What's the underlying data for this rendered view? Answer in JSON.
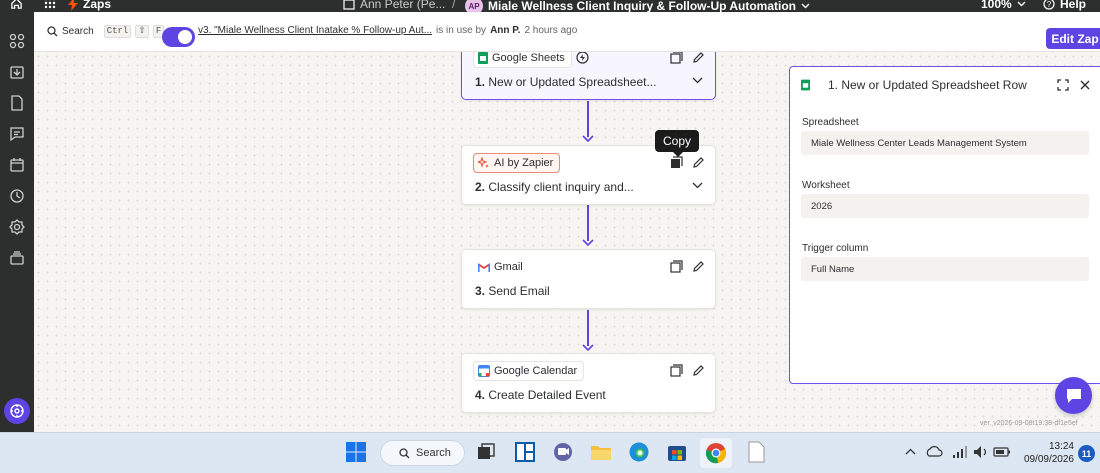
{
  "topbar": {
    "app_label": "Zaps",
    "owner": "Ann Peter (Pe...",
    "breadcrumb_separator": "/",
    "avatar_initials": "AP",
    "zap_title": "Miale Wellness Client Inquiry & Follow-Up Automation",
    "zoom": "100%",
    "help": "Help"
  },
  "subheader": {
    "search_label": "Search",
    "shortcut_keys": [
      "Ctrl",
      "⇧",
      "F"
    ],
    "toggle_on": true,
    "version_text": "v3. \"Miale Wellness Client Inatake % Follow-up Aut...",
    "in_use_text": "is in use by",
    "in_use_user": "Ann P.",
    "time_ago": "2 hours ago",
    "edit_button": "Edit Zap"
  },
  "steps": [
    {
      "app": "Google Sheets",
      "number": "1.",
      "title": "New or Updated Spreadsheet...",
      "selected": true,
      "icon": "google-sheets-icon"
    },
    {
      "app": "AI by Zapier",
      "number": "2.",
      "title": "Classify client inquiry and...",
      "selected": false,
      "icon": "ai-sparkle-icon"
    },
    {
      "app": "Gmail",
      "number": "3.",
      "title": "Send Email",
      "selected": false,
      "icon": "gmail-icon"
    },
    {
      "app": "Google Calendar",
      "number": "4.",
      "title": "Create Detailed Event",
      "selected": false,
      "icon": "google-calendar-icon"
    }
  ],
  "tooltip": "Copy",
  "panel": {
    "title": "1. New or Updated Spreadsheet Row",
    "fields": [
      {
        "label": "Spreadsheet",
        "value": "Miale Wellness Center Leads Management System"
      },
      {
        "label": "Worksheet",
        "value": "2026"
      },
      {
        "label": "Trigger column",
        "value": "Full Name"
      }
    ]
  },
  "version_footer": "ver. v2026-09-08t19:38-df1e5ef",
  "taskbar": {
    "search_label": "Search",
    "time": "13:24",
    "date": "09/09/2026",
    "notifications": "11"
  },
  "colors": {
    "accent": "#5d44e3",
    "dark": "#2d2e2e",
    "zap_orange": "#ff4f00"
  }
}
